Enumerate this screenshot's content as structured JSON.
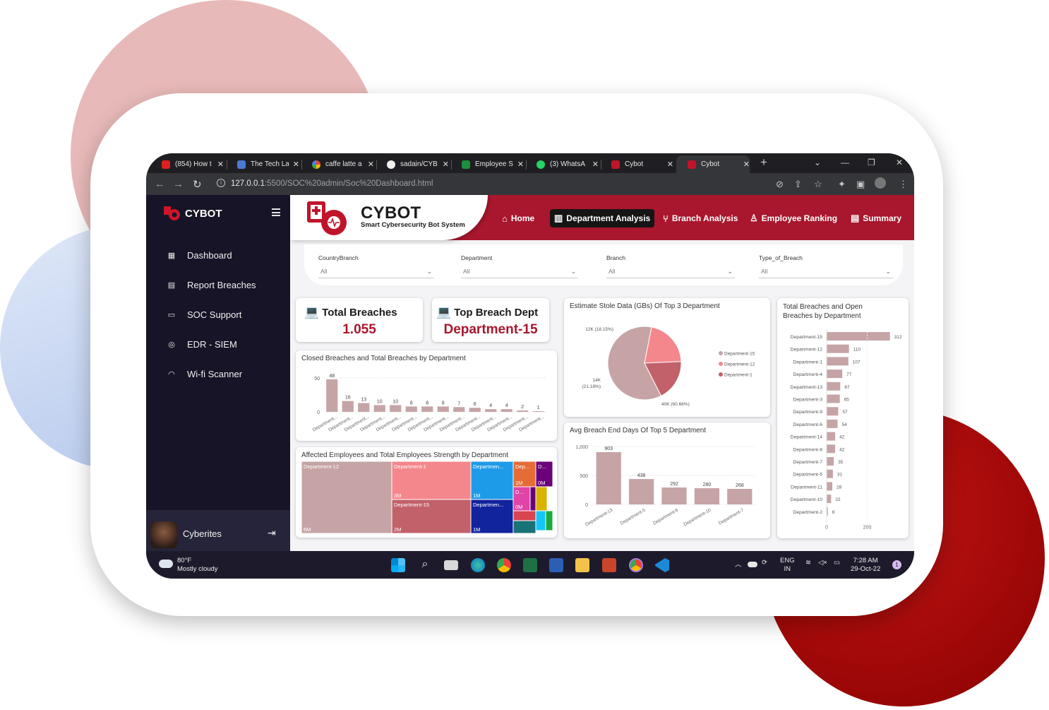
{
  "browser": {
    "tabs": [
      {
        "title": "(854) How t",
        "color": "#e02020"
      },
      {
        "title": "The Tech La",
        "color": "#4a7bd4"
      },
      {
        "title": "caffe latte a",
        "color": "#ffffff"
      },
      {
        "title": "sadain/CYB",
        "color": "#ffffff"
      },
      {
        "title": "Employee S",
        "color": "#1e8e3e"
      },
      {
        "title": "(3) WhatsA",
        "color": "#25d366"
      },
      {
        "title": "Cybot",
        "color": "#c0142a"
      },
      {
        "title": "Cybot",
        "color": "#c0142a"
      }
    ],
    "url_host": "127.0.0.1",
    "url_path": ":5500/SOC%20admin/Soc%20Dashboard.html"
  },
  "sidebar": {
    "brand": "CYBOT",
    "items": [
      {
        "label": "Dashboard",
        "icon": "grid-icon"
      },
      {
        "label": "Report Breaches",
        "icon": "document-icon"
      },
      {
        "label": "SOC Support",
        "icon": "chat-icon"
      },
      {
        "label": "EDR - SIEM",
        "icon": "radar-icon"
      },
      {
        "label": "Wi-fi Scanner",
        "icon": "wifi-icon"
      }
    ],
    "user": "Cyberites"
  },
  "header": {
    "title": "CYBOT",
    "subtitle": "Smart Cybersecurity Bot System",
    "nav": [
      {
        "label": "Home",
        "icon": "home-icon"
      },
      {
        "label": "Department Analysis",
        "icon": "bar-chart-icon"
      },
      {
        "label": "Branch Analysis",
        "icon": "branch-icon"
      },
      {
        "label": "Employee Ranking",
        "icon": "ranking-icon"
      },
      {
        "label": "Summary",
        "icon": "summary-icon"
      }
    ]
  },
  "filters": [
    {
      "label": "CountryBranch",
      "value": "All"
    },
    {
      "label": "Department",
      "value": "All"
    },
    {
      "label": "Branch",
      "value": "All"
    },
    {
      "label": "Type_of_Breach",
      "value": "All"
    }
  ],
  "kpis": {
    "total_breaches": {
      "title": "Total Breaches",
      "value": "1.055"
    },
    "top_breach_dept": {
      "title": "Top Breach Dept",
      "value": "Department-15"
    }
  },
  "colors": {
    "accent": "#a8172d",
    "bar": "#c6a4a6",
    "sidebar": "#161426"
  },
  "chart_data": [
    {
      "type": "bar",
      "title": "Closed Breaches and Total Breaches by Department",
      "categories": [
        "Department...",
        "Department...",
        "Department...",
        "Department...",
        "Department...",
        "Department...",
        "Department...",
        "Department...",
        "Department...",
        "Department...",
        "Department...",
        "Department...",
        "Department...",
        "Department..."
      ],
      "values": [
        48,
        16,
        13,
        10,
        10,
        8,
        8,
        8,
        7,
        6,
        4,
        4,
        2,
        1
      ],
      "yticks": [
        "50",
        "0"
      ],
      "ylim": [
        0,
        50
      ]
    },
    {
      "type": "pie",
      "title": "Estimate Stole Data (GBs) Of Top 3 Department",
      "series": [
        {
          "name": "Department-15",
          "value": 40,
          "label": "40K (60.68%)",
          "color": "#c6a4a6"
        },
        {
          "name": "Department-12",
          "value": 14,
          "label": "14K (21.18%)",
          "color": "#f4878c"
        },
        {
          "name": "Department-1",
          "value": 12,
          "label": "12K (18.15%)",
          "color": "#c2616a"
        }
      ],
      "legend": "right"
    },
    {
      "type": "bar",
      "orientation": "horizontal",
      "title": "Total Breaches and Open Breaches by Department",
      "categories": [
        "Department-15",
        "Department-12",
        "Department-1",
        "Department-4",
        "Department-13",
        "Department-3",
        "Department-9",
        "Department-6",
        "Department-14",
        "Department-8",
        "Department-7",
        "Department-5",
        "Department-11",
        "Department-10",
        "Department-2"
      ],
      "values": [
        312,
        110,
        107,
        77,
        67,
        65,
        57,
        54,
        42,
        42,
        35,
        31,
        28,
        22,
        6
      ],
      "xticks": [
        "0",
        "200"
      ],
      "xlim": [
        0,
        320
      ]
    },
    {
      "type": "bar",
      "title": "Avg Breach End Days Of Top 5 Department",
      "categories": [
        "Department-13",
        "Department-5",
        "Department-6",
        "Department-10",
        "Department-7"
      ],
      "values": [
        903,
        438,
        292,
        280,
        268
      ],
      "yticks": [
        "1,000",
        "500",
        "0"
      ],
      "ylim": [
        0,
        1000
      ]
    },
    {
      "type": "heatmap",
      "title": "Affected Employees and Total Employees Strength by Department",
      "cells": [
        {
          "label": "Department-12",
          "value": "6M",
          "color": "#c6a4a6"
        },
        {
          "label": "Department-1",
          "value": "3M",
          "color": "#f4878c"
        },
        {
          "label": "Department-15",
          "value": "2M",
          "color": "#c2616a"
        },
        {
          "label": "Departmen...",
          "value": "1M",
          "color": "#1e9be8"
        },
        {
          "label": "Departmen...",
          "value": "1M",
          "color": "#12239e"
        },
        {
          "label": "Dep...",
          "value": "1M",
          "color": "#e66c37"
        },
        {
          "label": "D...",
          "value": "0M",
          "color": "#6b007b"
        },
        {
          "label": "D...",
          "value": "0M",
          "color": "#e044a7"
        }
      ]
    }
  ],
  "taskbar": {
    "temp": "80°F",
    "weather": "Mostly cloudy",
    "lang": "ENG",
    "region": "IN",
    "time": "7:28 AM",
    "date": "29-Oct-22",
    "notifications": "1"
  }
}
